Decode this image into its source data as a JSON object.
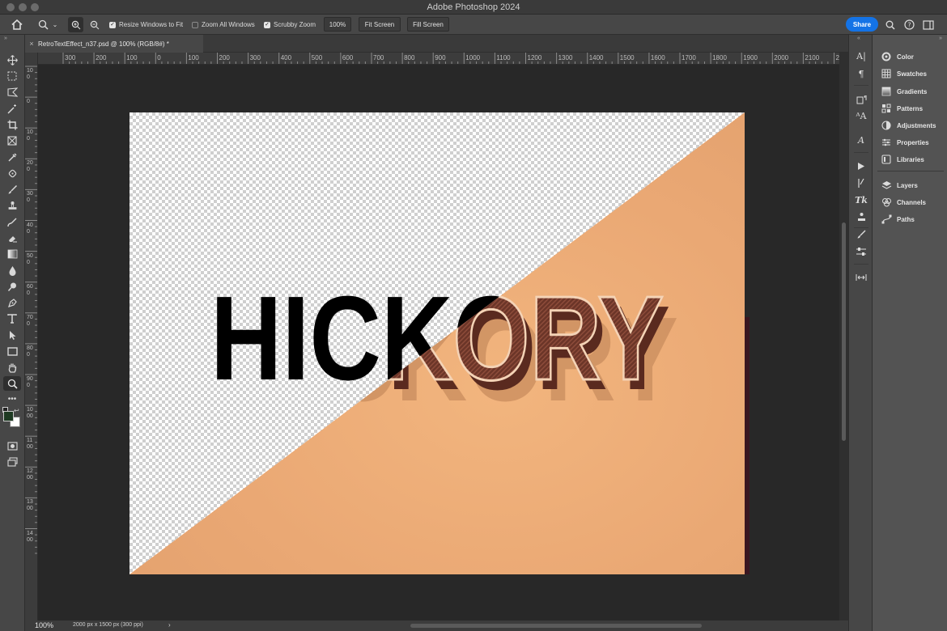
{
  "window": {
    "title": "Adobe Photoshop 2024"
  },
  "options_bar": {
    "resize_windows_label": "Resize Windows to Fit",
    "resize_windows_checked": true,
    "zoom_all_label": "Zoom All Windows",
    "zoom_all_checked": false,
    "scrubby_zoom_label": "Scrubby Zoom",
    "scrubby_zoom_checked": true,
    "zoom_value": "100%",
    "fit_screen_label": "Fit Screen",
    "fill_screen_label": "Fill Screen",
    "share_label": "Share"
  },
  "document": {
    "tab_title": "RetroTextEffect_n37.psd @ 100% (RGB/8#) *",
    "close_glyph": "×"
  },
  "rulers": {
    "horizontal": [
      "300",
      "200",
      "100",
      "0",
      "100",
      "200",
      "300",
      "400",
      "500",
      "600",
      "700",
      "800",
      "900",
      "1000",
      "1100",
      "1200",
      "1300",
      "1400",
      "1500",
      "1600",
      "1700",
      "1800",
      "1900",
      "2000",
      "2100",
      "220"
    ],
    "vertical": [
      "100",
      "0",
      "100",
      "200",
      "300",
      "400",
      "500",
      "600",
      "700",
      "800",
      "900",
      "1000",
      "1100",
      "1200",
      "1300",
      "1400"
    ]
  },
  "artwork": {
    "text": "HICKORY",
    "colors": {
      "paper": "#eaa874",
      "outline_text": "#000000",
      "retro_fill": "#6b3528",
      "retro_stroke": "#f4d3b6",
      "shadow": "#c98d5e"
    }
  },
  "status_bar": {
    "zoom": "100%",
    "doc_size": "2000 px x 1500 px (300 ppi)",
    "arrow": "›"
  },
  "panels": [
    {
      "label": "Color",
      "icon": "color-wheel-icon"
    },
    {
      "label": "Swatches",
      "icon": "swatches-grid-icon"
    },
    {
      "label": "Gradients",
      "icon": "gradient-icon"
    },
    {
      "label": "Patterns",
      "icon": "patterns-grid-icon"
    },
    {
      "label": "Adjustments",
      "icon": "adjustments-icon"
    },
    {
      "label": "Properties",
      "icon": "properties-sliders-icon"
    },
    {
      "label": "Libraries",
      "icon": "libraries-icon"
    },
    {
      "label": "Layers",
      "icon": "layers-icon"
    },
    {
      "label": "Channels",
      "icon": "channels-icon"
    },
    {
      "label": "Paths",
      "icon": "paths-icon"
    }
  ],
  "colors": {
    "accent": "#1473e6",
    "foreground_swatch": "#1e3a22",
    "background_swatch": "#ffffff"
  }
}
